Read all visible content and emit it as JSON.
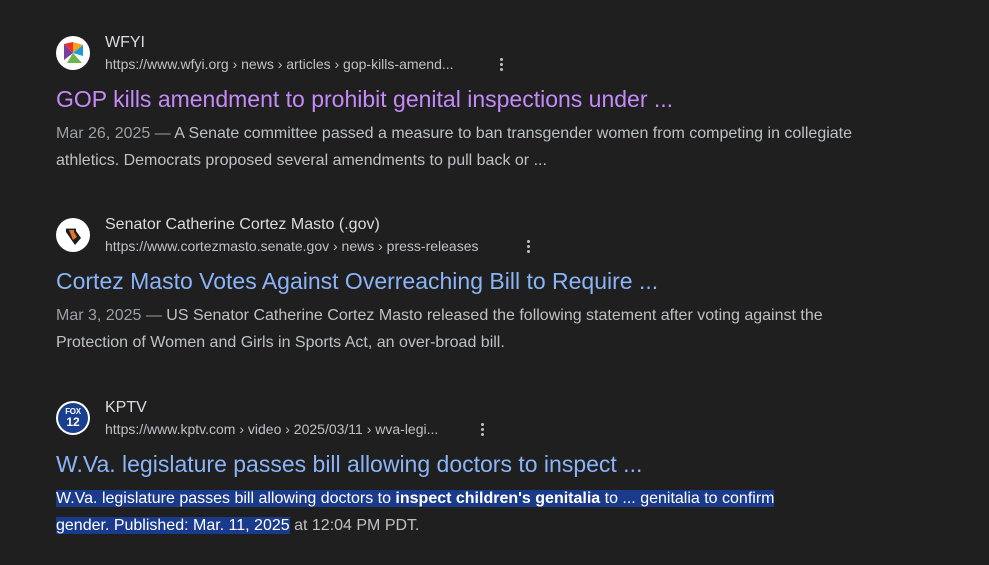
{
  "results": [
    {
      "site_name": "WFYI",
      "url": "https://www.wfyi.org › news › articles › gop-kills-amend...",
      "title": "GOP kills amendment to prohibit genital inspections under ...",
      "date": "Mar 26, 2025",
      "snippet": "A Senate committee passed a measure to ban transgender women from competing in collegiate athletics. Democrats proposed several amendments to pull back or ...",
      "favicon": "wfyi-logo-icon"
    },
    {
      "site_name": "Senator Catherine Cortez Masto (.gov)",
      "url": "https://www.cortezmasto.senate.gov › news › press-releases",
      "title": "Cortez Masto Votes Against Overreaching Bill to Require ...",
      "date": "Mar 3, 2025",
      "snippet": "US Senator Catherine Cortez Masto released the following statement after voting against the Protection of Women and Girls in Sports Act, an over-broad bill.",
      "favicon": "nevada-state-icon"
    },
    {
      "site_name": "KPTV",
      "url": "https://www.kptv.com › video › 2025/03/11 › wva-legi...",
      "title": "W.Va. legislature passes bill allowing doctors to inspect ...",
      "snippet_part1": "W.Va. legislature passes bill allowing doctors to ",
      "snippet_bold": "inspect children's genitalia",
      "snippet_part2": " to ... genitalia to confirm",
      "snippet_part3": "gender. Published: Mar. 11, 2025",
      "snippet_part4": " at 12:04 PM PDT.",
      "favicon": "fox12-logo-icon",
      "favicon_text_top": "FOX",
      "favicon_text_bottom": "12"
    }
  ],
  "date_separator": " — ",
  "colors": {
    "background": "#1f1f1f",
    "visited_link": "#c58af9",
    "link": "#8ab4f8",
    "selection": "#1a3a8c"
  }
}
